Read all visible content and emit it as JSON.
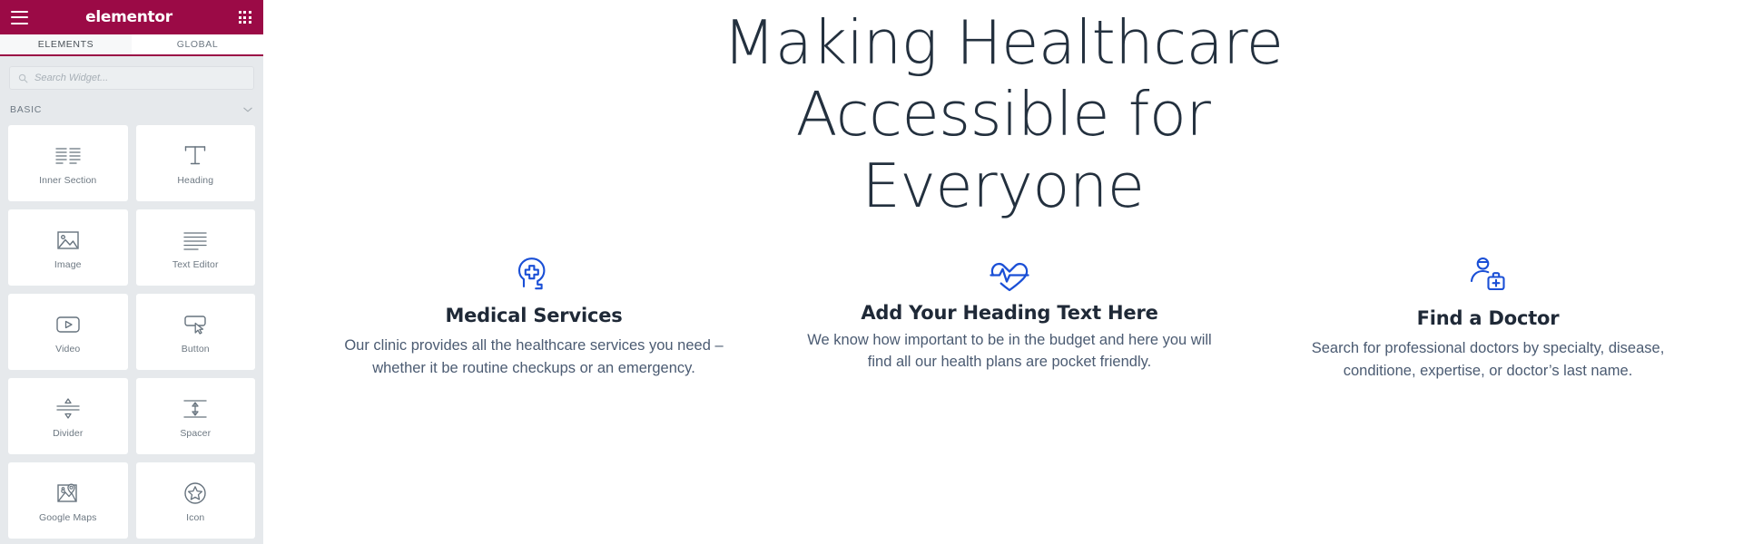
{
  "panel": {
    "logo": "elementor",
    "menu_icon": "hamburger-icon",
    "apps_icon": "apps-grid-icon",
    "tabs": [
      {
        "label": "ELEMENTS",
        "active": true
      },
      {
        "label": "GLOBAL",
        "active": false
      }
    ],
    "search": {
      "placeholder": "Search Widget...",
      "value": "",
      "icon": "search-icon"
    },
    "category": {
      "label": "BASIC",
      "expanded": true,
      "chevron": "chevron-down-icon"
    },
    "widgets": [
      {
        "label": "Inner Section",
        "icon": "inner-section-icon"
      },
      {
        "label": "Heading",
        "icon": "heading-icon"
      },
      {
        "label": "Image",
        "icon": "image-icon"
      },
      {
        "label": "Text Editor",
        "icon": "text-editor-icon"
      },
      {
        "label": "Video",
        "icon": "video-icon"
      },
      {
        "label": "Button",
        "icon": "button-icon"
      },
      {
        "label": "Divider",
        "icon": "divider-icon"
      },
      {
        "label": "Spacer",
        "icon": "spacer-icon"
      },
      {
        "label": "Google Maps",
        "icon": "google-maps-icon"
      },
      {
        "label": "Icon",
        "icon": "star-icon"
      }
    ],
    "collapse": {
      "icon": "chevron-left-icon"
    },
    "colors": {
      "header_bg": "#9B0A46",
      "panel_bg": "#E6E9EC",
      "card_bg": "#FFFFFF",
      "label": "#6D7882"
    }
  },
  "canvas": {
    "hero": {
      "title": "Making Healthcare Accessible for Everyone"
    },
    "features": [
      {
        "icon": "head-medical-cross-icon",
        "title": "Medical Services",
        "text": "Our clinic provides all the healthcare services you need – whether it be routine checkups or an emergency."
      },
      {
        "icon": "heart-pulse-icon",
        "title": "Add Your Heading Text Here",
        "text": "We know how important to be in the budget and here you will find all our health plans are pocket friendly."
      },
      {
        "icon": "doctor-bag-icon",
        "title": "Find a Doctor",
        "text": "Search for professional doctors by specialty, disease, conditione, expertise, or doctor’s last name."
      }
    ],
    "colors": {
      "heading": "#23303E",
      "feature_title": "#1F2937",
      "body_text": "#4B5B72",
      "icon_accent": "#1A4FD6"
    }
  }
}
